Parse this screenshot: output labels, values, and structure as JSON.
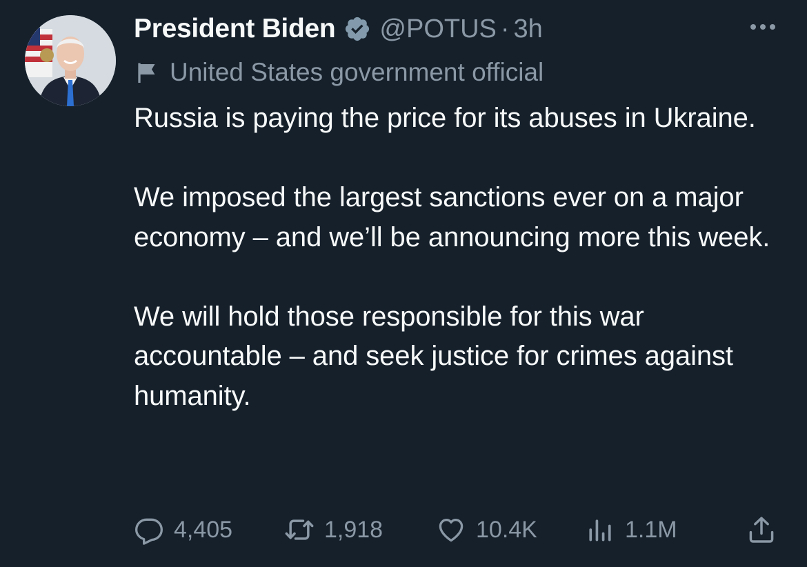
{
  "author": {
    "name": "President Biden",
    "handle": "@POTUS",
    "separator": "·",
    "time": "3h",
    "verified": true,
    "affiliation": "United States government official"
  },
  "tweet": {
    "paragraphs": [
      "Russia is paying the price for its abuses in Ukraine.",
      "We imposed the largest sanctions ever on a major economy – and we’ll be announcing more this week.",
      "We will hold those responsible for this war accountable – and seek justice for crimes against humanity."
    ]
  },
  "actions": {
    "replies": "4,405",
    "retweets": "1,918",
    "likes": "10.4K",
    "views": "1.1M"
  },
  "colors": {
    "background": "#15202b",
    "text": "#f7f9f9",
    "muted": "#8b98a5",
    "verified_badge": "#829aab"
  },
  "icons": {
    "more": "more-horizontal-icon",
    "verified": "verified-badge-icon",
    "affiliation": "flag-icon",
    "reply": "reply-icon",
    "retweet": "retweet-icon",
    "like": "heart-icon",
    "views": "analytics-icon",
    "share": "share-icon"
  }
}
